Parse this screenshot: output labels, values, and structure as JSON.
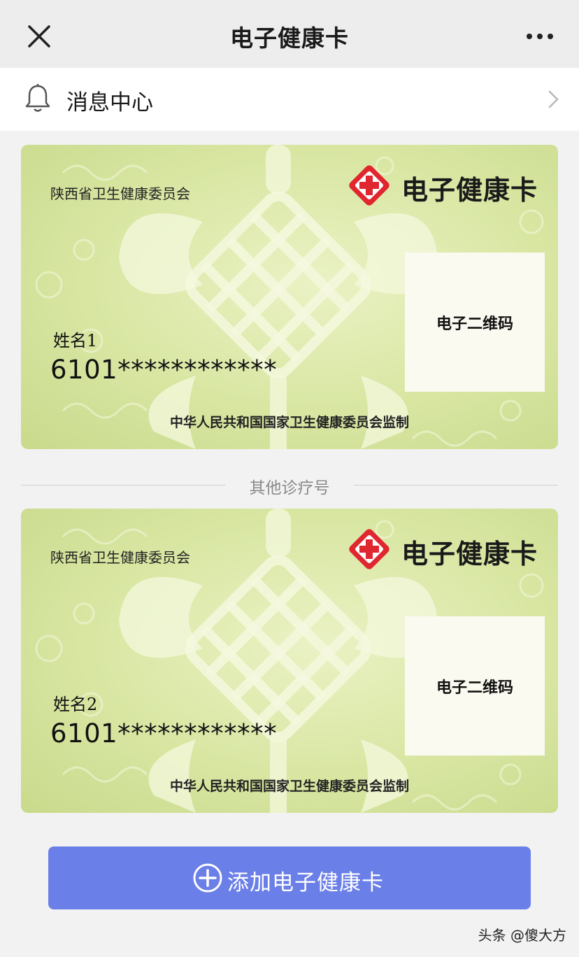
{
  "header": {
    "title": "电子健康卡"
  },
  "message_center": {
    "label": "消息中心"
  },
  "cards": [
    {
      "org": "陕西省卫生健康委员会",
      "brand": "电子健康卡",
      "qr_label": "电子二维码",
      "name": "姓名1",
      "id_number": "6101************",
      "footer": "中华人民共和国国家卫生健康委员会监制"
    },
    {
      "org": "陕西省卫生健康委员会",
      "brand": "电子健康卡",
      "qr_label": "电子二维码",
      "name": "姓名2",
      "id_number": "6101************",
      "footer": "中华人民共和国国家卫生健康委员会监制"
    }
  ],
  "divider": {
    "label": "其他诊疗号"
  },
  "add_button": {
    "label": "添加电子健康卡"
  },
  "watermark": {
    "text": "头条 @傻大方"
  },
  "colors": {
    "accent": "#6b7fe8",
    "cross_red": "#e0262f",
    "card_green": "#d8e6a2"
  }
}
